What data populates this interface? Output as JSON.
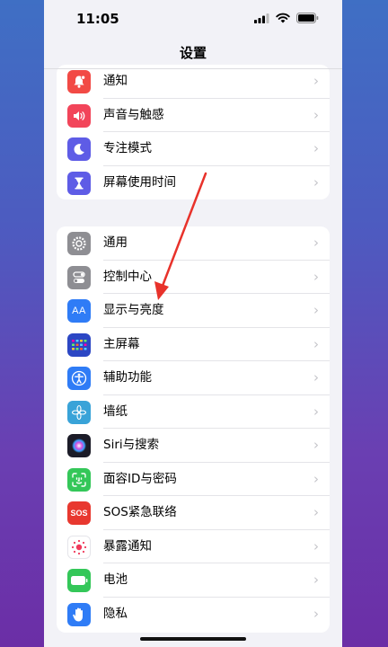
{
  "status": {
    "time": "11:05"
  },
  "nav": {
    "title": "设置"
  },
  "group1": [
    {
      "key": "notifications",
      "label": "通知",
      "color": "#f24a45",
      "icon": "bell-icon"
    },
    {
      "key": "sounds",
      "label": "声音与触感",
      "color": "#f2455a",
      "icon": "speaker-icon"
    },
    {
      "key": "focus",
      "label": "专注模式",
      "color": "#5e5ce6",
      "icon": "moon-icon"
    },
    {
      "key": "screen-time",
      "label": "屏幕使用时间",
      "color": "#5e5ce6",
      "icon": "hourglass-icon"
    }
  ],
  "group2": [
    {
      "key": "general",
      "label": "通用",
      "color": "#8e8e93",
      "icon": "gear-icon"
    },
    {
      "key": "control-center",
      "label": "控制中心",
      "color": "#8e8e93",
      "icon": "toggle-icon"
    },
    {
      "key": "display",
      "label": "显示与亮度",
      "color": "#2f7cf6",
      "icon": "text-size-icon",
      "glyph": "AA"
    },
    {
      "key": "home-screen",
      "label": "主屏幕",
      "color": "#2c47c4",
      "icon": "grid-icon"
    },
    {
      "key": "accessibility",
      "label": "辅助功能",
      "color": "#2f7cf6",
      "icon": "accessibility-icon"
    },
    {
      "key": "wallpaper",
      "label": "墙纸",
      "color": "#39a3d8",
      "icon": "flower-icon"
    },
    {
      "key": "siri",
      "label": "Siri与搜索",
      "color": "#222233",
      "icon": "siri-icon"
    },
    {
      "key": "face-id",
      "label": "面容ID与密码",
      "color": "#34c759",
      "icon": "face-id-icon"
    },
    {
      "key": "sos",
      "label": "SOS紧急联络",
      "color": "#e8382f",
      "icon": "sos-icon",
      "glyph": "SOS"
    },
    {
      "key": "exposure",
      "label": "暴露通知",
      "color": "#ffffff",
      "icon": "exposure-icon"
    },
    {
      "key": "battery",
      "label": "电池",
      "color": "#34c759",
      "icon": "battery-icon"
    },
    {
      "key": "privacy",
      "label": "隐私",
      "color": "#2f7cf6",
      "icon": "hand-icon"
    }
  ],
  "chevron": "›",
  "annotation": {
    "color": "#e8322b",
    "icon": "arrow-annotation"
  }
}
